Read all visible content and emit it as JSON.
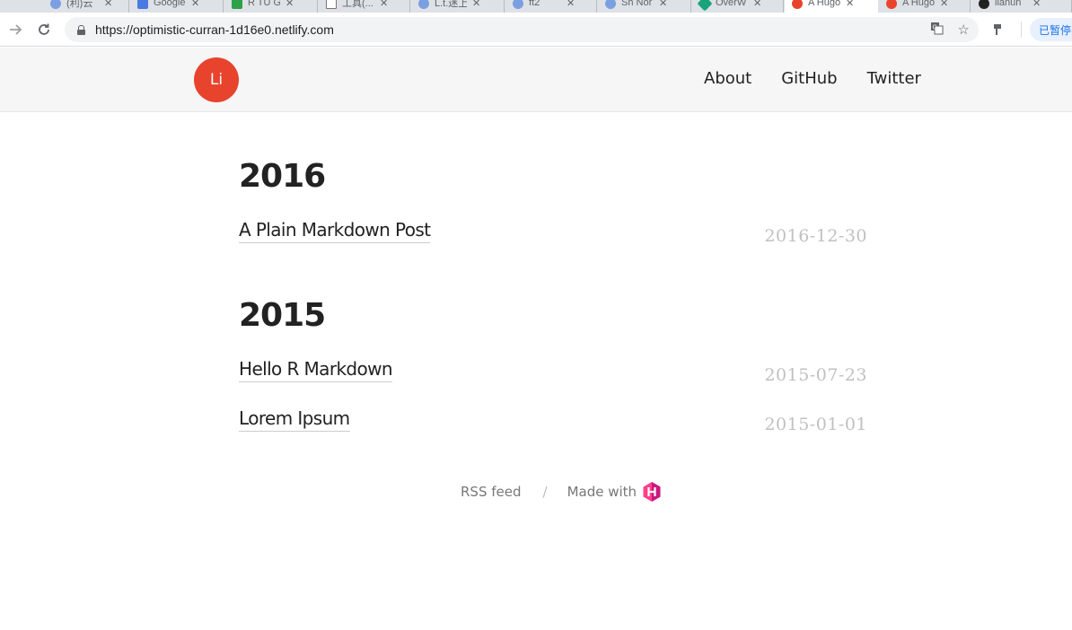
{
  "browser": {
    "tabs": [
      {
        "title": "(利)云",
        "color": "#7b9fe0"
      },
      {
        "title": "Google",
        "color": "#4a7be3"
      },
      {
        "title": "R TU G",
        "color": "#2ca14a"
      },
      {
        "title": "工具(...",
        "color": "#ffffff"
      },
      {
        "title": "L.t.迷上",
        "color": "#7b9fe0"
      },
      {
        "title": "ft2",
        "color": "#7b9fe0"
      },
      {
        "title": "Sh Nor",
        "color": "#7b9fe0"
      },
      {
        "title": "OverW",
        "color": "#1aa37a"
      },
      {
        "title": "A Hugo",
        "color": "#e8432d"
      },
      {
        "title": "A Hugo",
        "color": "#e8432d"
      },
      {
        "title": "lianun",
        "color": "#222222"
      }
    ],
    "url": "https://optimistic-curran-1d16e0.netlify.com",
    "paused_label": "已暂停"
  },
  "site": {
    "logo_text": "Li",
    "nav": [
      "About",
      "GitHub",
      "Twitter"
    ]
  },
  "archive": [
    {
      "year": "2016",
      "posts": [
        {
          "title": "A Plain Markdown Post",
          "date": "2016-12-30"
        }
      ]
    },
    {
      "year": "2015",
      "posts": [
        {
          "title": "Hello R Markdown",
          "date": "2015-07-23"
        },
        {
          "title": "Lorem Ipsum",
          "date": "2015-01-01"
        }
      ]
    }
  ],
  "footer": {
    "rss": "RSS feed",
    "separator": "/",
    "made_with": "Made with",
    "hugo_color": "#ff4088"
  }
}
